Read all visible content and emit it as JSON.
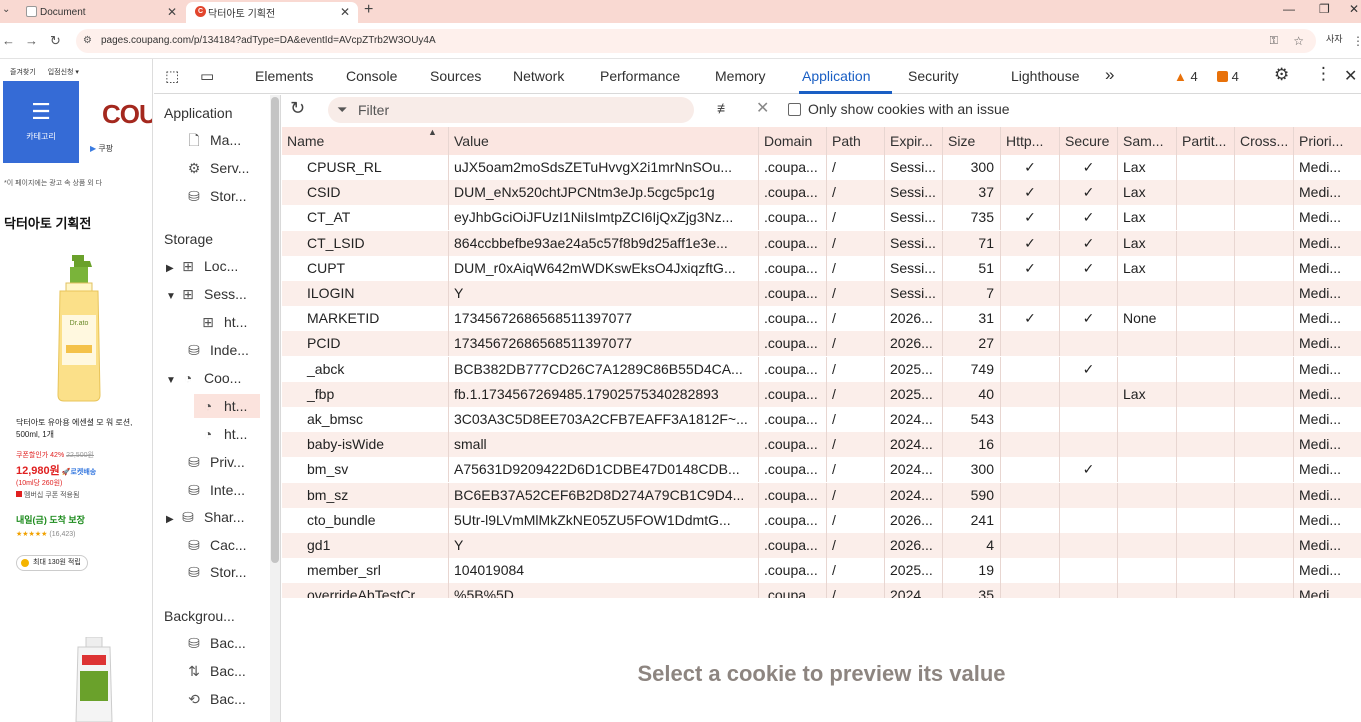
{
  "browser": {
    "tabs": [
      {
        "title": "Document"
      },
      {
        "title": "닥터아토 기획전"
      }
    ],
    "url": "pages.coupang.com/p/134184?adType=DA&eventId=AVcpZTrb2W3OUy4A",
    "ext_label": "사자"
  },
  "webpage": {
    "bookmarks": [
      "즐겨찾기",
      "입점신청 ▾"
    ],
    "category_label": "카테고리",
    "logo_text": "COU",
    "play_text": "쿠팡",
    "ad_notice": "*이 페이지에는 광고 속 상품 외 다",
    "promo_title": "닥터아토 기획전",
    "product_name": "닥터아토 유아용 에센셜 모 워 로션, 500ml, 1개",
    "coupon_label": "쿠폰할인가",
    "discount": "42%",
    "original_price": "22,500원",
    "price": "12,980원",
    "rocket": "로켓배송",
    "unit_price": "(10ml당 260원)",
    "wow_line": "멤버십 쿠폰 적용됨",
    "delivery": "내일(금) 도착 보장",
    "stars": "★★★★★",
    "review_count": "(16,423)",
    "reward": "최대 130원 적립"
  },
  "devtools": {
    "tabs": [
      "Elements",
      "Console",
      "Sources",
      "Network",
      "Performance",
      "Memory",
      "Application",
      "Security",
      "Lighthouse"
    ],
    "active_tab": "Application",
    "more_tabs": "»",
    "warnings": "4",
    "issues": "4",
    "sidebar": {
      "application_head": "Application",
      "application_items": [
        {
          "label": "Ma...",
          "icon": "file-icon"
        },
        {
          "label": "Serv...",
          "icon": "gears-icon"
        },
        {
          "label": "Stor...",
          "icon": "database-icon"
        }
      ],
      "storage_head": "Storage",
      "storage_items": [
        {
          "label": "Loc...",
          "icon": "grid-icon",
          "expander": "▶",
          "indent": 0
        },
        {
          "label": "Sess...",
          "icon": "grid-icon",
          "expander": "▼",
          "indent": 0
        },
        {
          "label": "ht...",
          "icon": "grid-icon",
          "expander": "",
          "indent": 1
        },
        {
          "label": "Inde...",
          "icon": "database-icon",
          "expander": "",
          "indent": 0
        },
        {
          "label": "Coo...",
          "icon": "cookie-icon",
          "expander": "▼",
          "indent": 0
        },
        {
          "label": "ht...",
          "icon": "cookie-icon",
          "expander": "",
          "indent": 1,
          "selected": true
        },
        {
          "label": "ht...",
          "icon": "cookie-icon",
          "expander": "",
          "indent": 1
        },
        {
          "label": "Priv...",
          "icon": "database-icon",
          "expander": "",
          "indent": 0
        },
        {
          "label": "Inte...",
          "icon": "database-icon",
          "expander": "",
          "indent": 0
        },
        {
          "label": "Shar...",
          "icon": "database-icon",
          "expander": "▶",
          "indent": 0
        },
        {
          "label": "Cac...",
          "icon": "database-icon",
          "expander": "",
          "indent": 0
        },
        {
          "label": "Stor...",
          "icon": "database-icon",
          "expander": "",
          "indent": 0
        }
      ],
      "background_head": "Backgrou...",
      "background_items": [
        {
          "label": "Bac...",
          "icon": "database-icon"
        },
        {
          "label": "Bac...",
          "icon": "arrows-icon"
        },
        {
          "label": "Bac...",
          "icon": "sync-icon"
        }
      ]
    },
    "filter": {
      "placeholder": "Filter",
      "only_issue_label": "Only show cookies with an issue"
    },
    "table": {
      "columns": [
        "Name",
        "Value",
        "Domain",
        "Path",
        "Expir...",
        "Size",
        "Http...",
        "Secure",
        "Sam...",
        "Partit...",
        "Cross...",
        "Priori..."
      ],
      "rows": [
        [
          "CPUSR_RL",
          "uJX5oam2moSdsZETuHvvgX2i1mrNnSOu...",
          ".coupa...",
          "/",
          "Sessi...",
          "300",
          "✓",
          "✓",
          "Lax",
          "",
          "",
          "Medi..."
        ],
        [
          "CSID",
          "DUM_eNx520chtJPCNtm3eJp.5cgc5pc1g",
          ".coupa...",
          "/",
          "Sessi...",
          "37",
          "✓",
          "✓",
          "Lax",
          "",
          "",
          "Medi..."
        ],
        [
          "CT_AT",
          "eyJhbGciOiJFUzI1NiIsImtpZCI6IjQxZjg3Nz...",
          ".coupa...",
          "/",
          "Sessi...",
          "735",
          "✓",
          "✓",
          "Lax",
          "",
          "",
          "Medi..."
        ],
        [
          "CT_LSID",
          "864ccbbefbe93ae24a5c57f8b9d25aff1e3e...",
          ".coupa...",
          "/",
          "Sessi...",
          "71",
          "✓",
          "✓",
          "Lax",
          "",
          "",
          "Medi..."
        ],
        [
          "CUPT",
          "DUM_r0xAiqW642mWDKswEksO4JxiqzftG...",
          ".coupa...",
          "/",
          "Sessi...",
          "51",
          "✓",
          "✓",
          "Lax",
          "",
          "",
          "Medi..."
        ],
        [
          "ILOGIN",
          "Y",
          ".coupa...",
          "/",
          "Sessi...",
          "7",
          "",
          "",
          "",
          "",
          "",
          "Medi..."
        ],
        [
          "MARKETID",
          "17345672686568511397077",
          ".coupa...",
          "/",
          "2026...",
          "31",
          "✓",
          "✓",
          "None",
          "",
          "",
          "Medi..."
        ],
        [
          "PCID",
          "17345672686568511397077",
          ".coupa...",
          "/",
          "2026...",
          "27",
          "",
          "",
          "",
          "",
          "",
          "Medi..."
        ],
        [
          "_abck",
          "BCB382DB777CD26C7A1289C86B55D4CA...",
          ".coupa...",
          "/",
          "2025...",
          "749",
          "",
          "✓",
          "",
          "",
          "",
          "Medi..."
        ],
        [
          "_fbp",
          "fb.1.1734567269485.17902575340282893",
          ".coupa...",
          "/",
          "2025...",
          "40",
          "",
          "",
          "Lax",
          "",
          "",
          "Medi..."
        ],
        [
          "ak_bmsc",
          "3C03A3C5D8EE703A2CFB7EAFF3A1812F~...",
          ".coupa...",
          "/",
          "2024...",
          "543",
          "",
          "",
          "",
          "",
          "",
          "Medi..."
        ],
        [
          "baby-isWide",
          "small",
          ".coupa...",
          "/",
          "2024...",
          "16",
          "",
          "",
          "",
          "",
          "",
          "Medi..."
        ],
        [
          "bm_sv",
          "A75631D9209422D6D1CDBE47D0148CDB...",
          ".coupa...",
          "/",
          "2024...",
          "300",
          "",
          "✓",
          "",
          "",
          "",
          "Medi..."
        ],
        [
          "bm_sz",
          "BC6EB37A52CEF6B2D8D274A79CB1C9D4...",
          ".coupa...",
          "/",
          "2024...",
          "590",
          "",
          "",
          "",
          "",
          "",
          "Medi..."
        ],
        [
          "cto_bundle",
          "5Utr-l9LVmMlMkZkNE05ZU5FOW1DdmtG...",
          ".coupa...",
          "/",
          "2026...",
          "241",
          "",
          "",
          "",
          "",
          "",
          "Medi..."
        ],
        [
          "gd1",
          "Y",
          ".coupa...",
          "/",
          "2026...",
          "4",
          "",
          "",
          "",
          "",
          "",
          "Medi..."
        ],
        [
          "member_srl",
          "104019084",
          ".coupa...",
          "/",
          "2025...",
          "19",
          "",
          "",
          "",
          "",
          "",
          "Medi..."
        ],
        [
          "overrideAbTestCr...",
          "%5B%5D",
          ".coupa...",
          "/",
          "2024...",
          "35",
          "",
          "",
          "",
          "",
          "",
          "Medi..."
        ]
      ]
    },
    "preview_text": "Select a cookie to preview its value"
  },
  "colors": {
    "accent": "#1a5fc4",
    "tabstrip": "#f9d9d2",
    "row_alt": "#fbeeea",
    "selected": "#fbe3dd",
    "warning": "#e8710a",
    "coupang_blue": "#356bd6",
    "price_red": "#e02020"
  }
}
